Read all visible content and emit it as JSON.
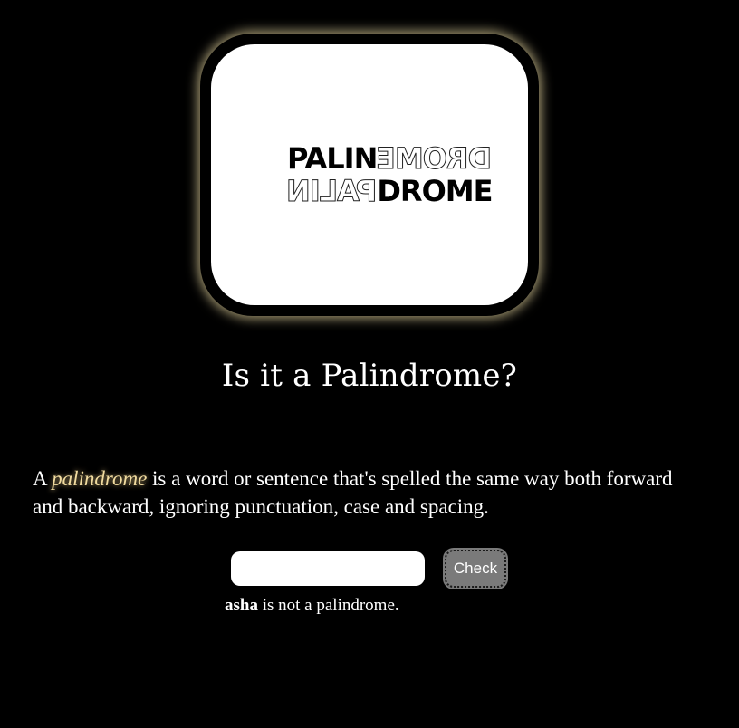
{
  "logo": {
    "top_left": "PALIN",
    "top_right": "DROME",
    "bottom_left": "PALIN",
    "bottom_right": "DROME"
  },
  "title": "Is it a Palindrome?",
  "description": {
    "prefix": "A",
    "term": "palindrome",
    "body": "is a word or sentence that's spelled the same way both forward and backward, ignoring punctuation, case and spacing."
  },
  "form": {
    "input_value": "",
    "input_placeholder": "",
    "check_label": "Check"
  },
  "result": {
    "word": "asha",
    "message": "is not a palindrome."
  },
  "colors": {
    "background": "#000000",
    "card": "#ffffff",
    "glow": "#d7c896",
    "highlight": "#f2dca0",
    "button": "#7a7a7a"
  }
}
